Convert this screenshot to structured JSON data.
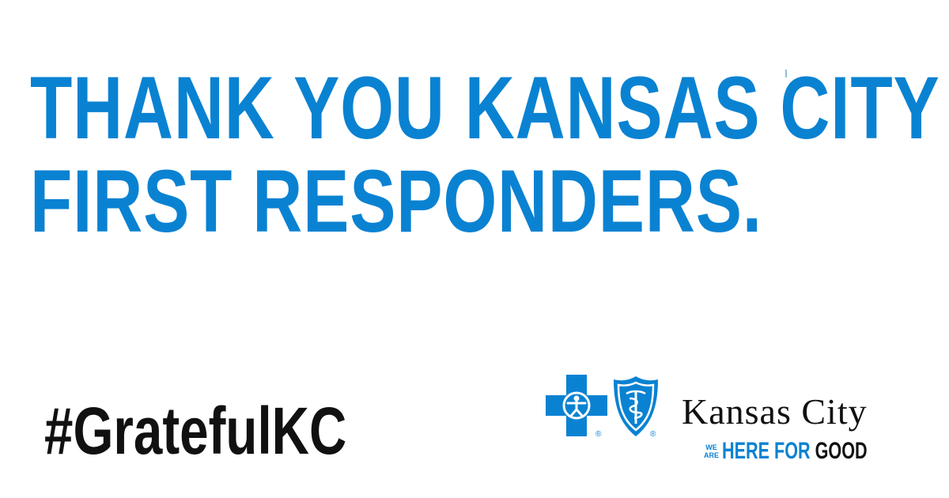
{
  "headline": {
    "line1": "THANK YOU KANSAS CITY",
    "line2": "FIRST RESPONDERS."
  },
  "hashtag": "#GratefulKC",
  "logo": {
    "cross_icon": "blue-cross-icon",
    "shield_icon": "blue-shield-icon",
    "registered_mark": "®",
    "city_name": "Kansas City",
    "tagline_we": "WE",
    "tagline_are": "ARE",
    "tagline_here_for": "HERE FOR",
    "tagline_good": "GOOD"
  },
  "colors": {
    "brand_blue": "#0a82d2",
    "text_dark": "#111111",
    "background": "#ffffff"
  }
}
